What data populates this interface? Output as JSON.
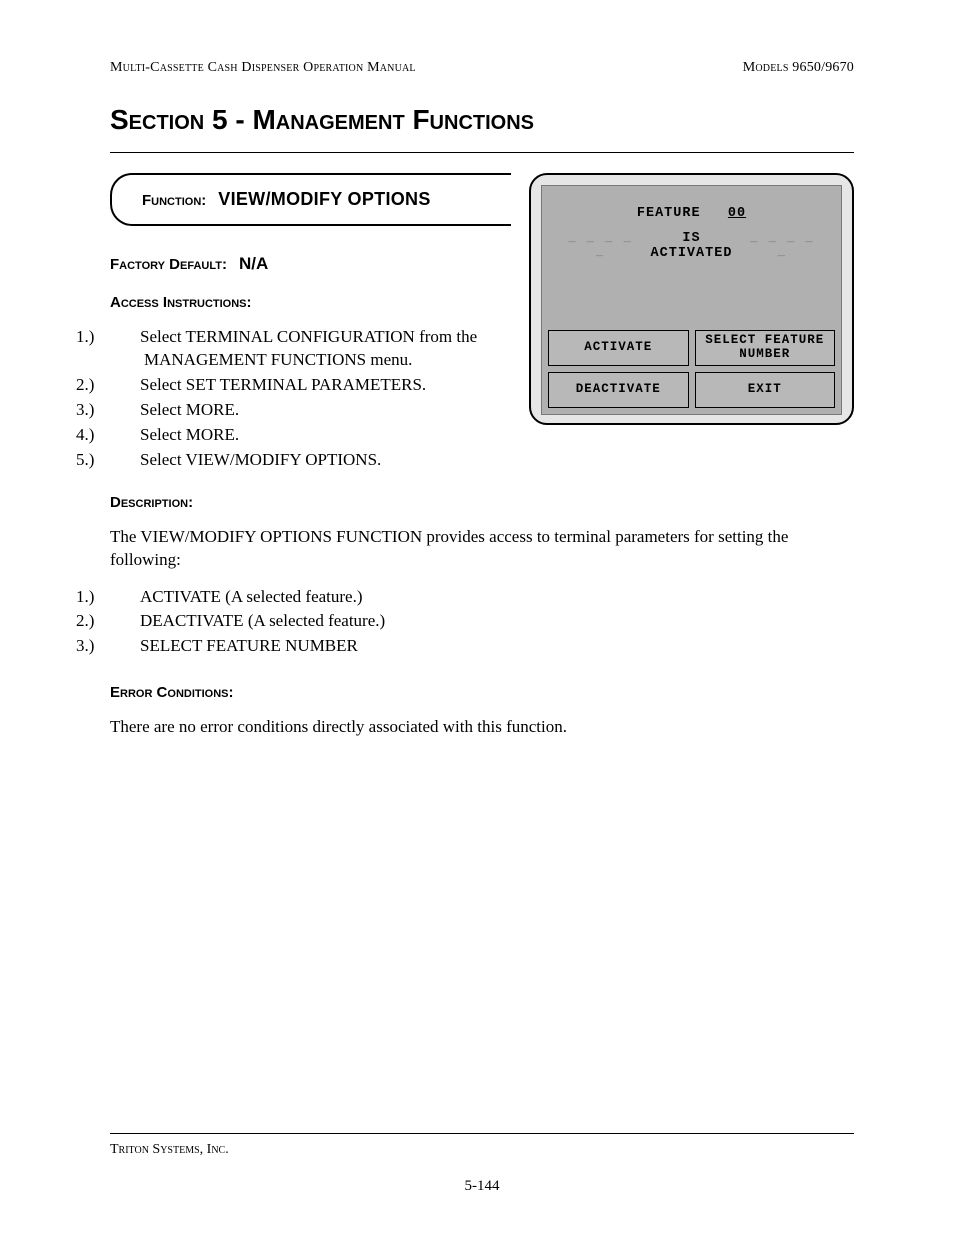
{
  "header": {
    "left": "Multi-Cassette Cash Dispenser Operation Manual",
    "right": "Models 9650/9670"
  },
  "section_title": "Section 5 - Management Functions",
  "function": {
    "label": "Function:",
    "name": "VIEW/MODIFY OPTIONS"
  },
  "factory_default": {
    "label": "Factory Default:",
    "value": "N/A"
  },
  "access": {
    "label": "Access Instructions:",
    "steps": [
      "Select TERMINAL CONFIGURATION from the MANAGEMENT FUNCTIONS menu.",
      "Select SET TERMINAL PARAMETERS.",
      "Select MORE.",
      "Select MORE.",
      "Select VIEW/MODIFY OPTIONS."
    ]
  },
  "description": {
    "label": "Description:",
    "intro": "The VIEW/MODIFY OPTIONS FUNCTION provides access to terminal parameters for setting the following:",
    "items": [
      "ACTIVATE (A selected feature.)",
      "DEACTIVATE (A selected feature.)",
      "SELECT FEATURE NUMBER"
    ]
  },
  "error": {
    "label": "Error Conditions:",
    "text": "There are no error conditions directly associated with this function."
  },
  "screen": {
    "feature_label": "FEATURE",
    "feature_value": "00",
    "status": "IS ACTIVATED",
    "buttons": {
      "activate": "ACTIVATE",
      "select_feature": "SELECT FEATURE NUMBER",
      "deactivate": "DEACTIVATE",
      "exit": "EXIT"
    }
  },
  "footer": {
    "company": "Triton Systems, Inc.",
    "page": "5-144"
  }
}
